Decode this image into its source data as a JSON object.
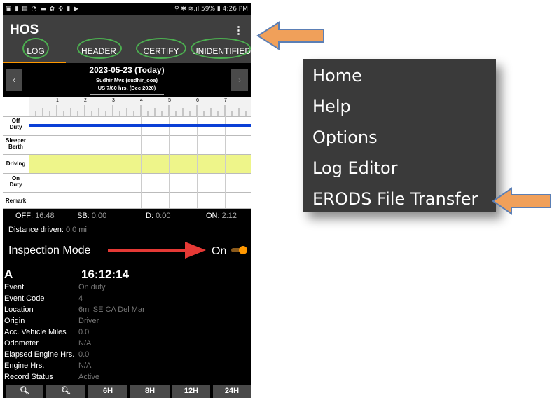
{
  "status_bar": {
    "left_icons": "▣ ▮ ▤ ◔ ▬ ✿ ✣ ▮ ▶",
    "right_text": "⚲ ✱ ≋.ıl 59% ▮ 4:26 PM"
  },
  "app": {
    "title": "HOS",
    "overflow_icon": "⋮"
  },
  "tabs": [
    {
      "label": "LOG"
    },
    {
      "label": "HEADER"
    },
    {
      "label": "CERTIFY"
    },
    {
      "label": "UNIDENTIFIED"
    }
  ],
  "date": {
    "title": "2023-05-23 (Today)",
    "driver": "Sudhir Mvs (sudhir_ooa)",
    "rule": "US 7/60 hrs. (Dec 2020)",
    "prev": "‹",
    "next": "›"
  },
  "grid": {
    "hours": [
      "1",
      "2",
      "3",
      "4",
      "5",
      "6",
      "7"
    ],
    "rows": [
      {
        "label_line1": "Off",
        "label_line2": "Duty"
      },
      {
        "label_line1": "Sleeper",
        "label_line2": "Berth"
      },
      {
        "label_line1": "Driving",
        "label_line2": ""
      },
      {
        "label_line1": "On",
        "label_line2": "Duty"
      },
      {
        "label_line1": "Remark",
        "label_line2": ""
      }
    ],
    "highlight_color": "#eef58a",
    "status_line_color": "#0a3fd6"
  },
  "totals": {
    "off_label": "OFF:",
    "off_value": "16:48",
    "sb_label": "SB:",
    "sb_value": "0:00",
    "d_label": "D:",
    "d_value": "0:00",
    "on_label": "ON:",
    "on_value": "2:12"
  },
  "distance": {
    "label": "Distance driven:",
    "value": "0.0 mi"
  },
  "inspection": {
    "label": "Inspection Mode",
    "value": "On"
  },
  "detail": {
    "code": "A",
    "time": "16:12:14",
    "rows": [
      {
        "label": "Event",
        "value": "On duty"
      },
      {
        "label": "Event Code",
        "value": "4"
      },
      {
        "label": "Location",
        "value": "6mi SE CA Del Mar"
      },
      {
        "label": "Origin",
        "value": "Driver"
      },
      {
        "label": "Acc. Vehicle Miles",
        "value": "0.0"
      },
      {
        "label": "Odometer",
        "value": "N/A"
      },
      {
        "label": "Elapsed Engine Hrs.",
        "value": "0.0"
      },
      {
        "label": "Engine Hrs.",
        "value": "N/A"
      },
      {
        "label": "Record Status",
        "value": "Active"
      }
    ]
  },
  "bottom_buttons": [
    {
      "label": "🔍︎"
    },
    {
      "label": "🔍︎"
    },
    {
      "label": "6H"
    },
    {
      "label": "8H"
    },
    {
      "label": "12H"
    },
    {
      "label": "24H"
    }
  ],
  "menu": {
    "items": [
      {
        "label": "Home"
      },
      {
        "label": "Help"
      },
      {
        "label": "Options"
      },
      {
        "label": "Log Editor"
      },
      {
        "label": "ERODS File Transfer"
      }
    ]
  },
  "colors": {
    "accent": "#ff9800",
    "tab_ring": "#4caf50",
    "callout_arrow": "#f0a05a",
    "red_arrow": "#e53935"
  }
}
